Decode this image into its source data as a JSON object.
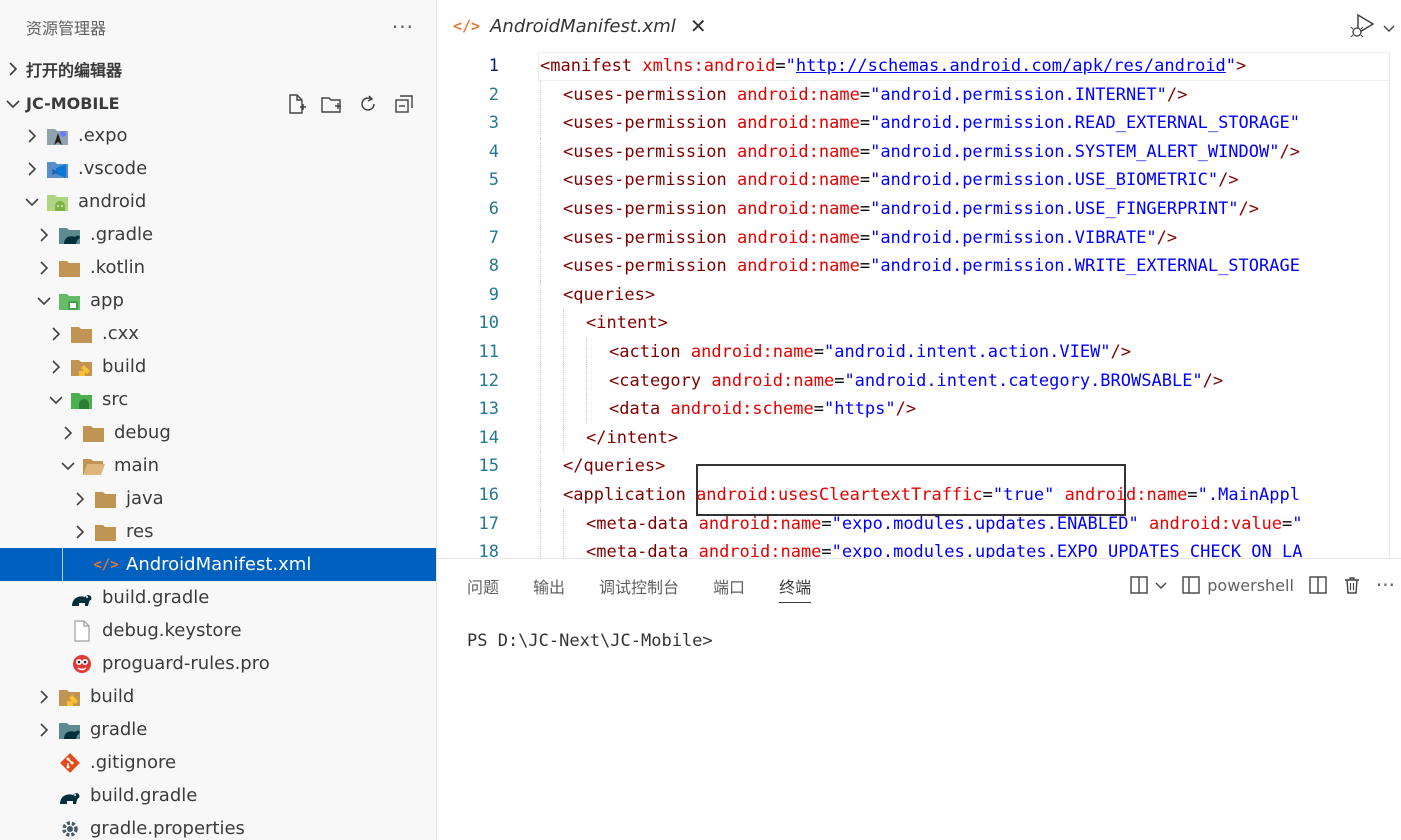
{
  "explorer": {
    "title": "资源管理器",
    "more": "···",
    "open_editors": "打开的编辑器",
    "workspace": "JC-MOBILE"
  },
  "tree": [
    {
      "label": ".expo",
      "level": 0,
      "chevron": "right",
      "icon": "expo-folder-icon"
    },
    {
      "label": ".vscode",
      "level": 0,
      "chevron": "right",
      "icon": "vscode-folder-icon"
    },
    {
      "label": "android",
      "level": 0,
      "chevron": "down",
      "icon": "android-folder-icon"
    },
    {
      "label": ".gradle",
      "level": 1,
      "chevron": "right",
      "icon": "gradle-folder-icon"
    },
    {
      "label": ".kotlin",
      "level": 1,
      "chevron": "right",
      "icon": "folder-icon"
    },
    {
      "label": "app",
      "level": 1,
      "chevron": "down",
      "icon": "app-folder-icon"
    },
    {
      "label": ".cxx",
      "level": 2,
      "chevron": "right",
      "icon": "folder-icon"
    },
    {
      "label": "build",
      "level": 2,
      "chevron": "right",
      "icon": "build-folder-icon"
    },
    {
      "label": "src",
      "level": 2,
      "chevron": "down",
      "icon": "src-folder-icon"
    },
    {
      "label": "debug",
      "level": 3,
      "chevron": "right",
      "icon": "folder-icon"
    },
    {
      "label": "main",
      "level": 3,
      "chevron": "down",
      "icon": "folder-open-icon"
    },
    {
      "label": "java",
      "level": 4,
      "chevron": "right",
      "icon": "folder-icon"
    },
    {
      "label": "res",
      "level": 4,
      "chevron": "right",
      "icon": "folder-icon"
    },
    {
      "label": "AndroidManifest.xml",
      "level": 4,
      "chevron": "none",
      "icon": "xml-file-icon",
      "selected": true
    },
    {
      "label": "build.gradle",
      "level": 2,
      "chevron": "none",
      "icon": "gradle-file-icon"
    },
    {
      "label": "debug.keystore",
      "level": 2,
      "chevron": "none",
      "icon": "file-icon"
    },
    {
      "label": "proguard-rules.pro",
      "level": 2,
      "chevron": "none",
      "icon": "proguard-file-icon"
    },
    {
      "label": "build",
      "level": 1,
      "chevron": "right",
      "icon": "build-folder-icon"
    },
    {
      "label": "gradle",
      "level": 1,
      "chevron": "right",
      "icon": "gradle-folder-icon"
    },
    {
      "label": ".gitignore",
      "level": 1,
      "chevron": "none",
      "icon": "git-file-icon"
    },
    {
      "label": "build.gradle",
      "level": 1,
      "chevron": "none",
      "icon": "gradle-file-icon"
    },
    {
      "label": "gradle.properties",
      "level": 1,
      "chevron": "none",
      "icon": "gear-file-icon"
    }
  ],
  "editor": {
    "tab_icon": "</>",
    "tab_label": "AndroidManifest.xml",
    "tab_close": "✕",
    "active_line": 1
  },
  "code_lines": [
    {
      "n": "1",
      "indent": 0,
      "t": [
        [
          "tg",
          "<manifest "
        ],
        [
          "at",
          "xmlns:android"
        ],
        [
          "tx",
          "="
        ],
        [
          "vl",
          "\""
        ],
        [
          "vlu",
          "http://schemas.android.com/apk/res/android"
        ],
        [
          "vl",
          "\""
        ],
        [
          "tg",
          ">"
        ]
      ]
    },
    {
      "n": "2",
      "indent": 1,
      "t": [
        [
          "tg",
          "<uses-permission "
        ],
        [
          "at",
          "android:name"
        ],
        [
          "tx",
          "="
        ],
        [
          "vl",
          "\"android.permission.INTERNET\""
        ],
        [
          "tg",
          "/>"
        ]
      ]
    },
    {
      "n": "3",
      "indent": 1,
      "t": [
        [
          "tg",
          "<uses-permission "
        ],
        [
          "at",
          "android:name"
        ],
        [
          "tx",
          "="
        ],
        [
          "vl",
          "\"android.permission.READ_EXTERNAL_STORAGE\""
        ]
      ]
    },
    {
      "n": "4",
      "indent": 1,
      "t": [
        [
          "tg",
          "<uses-permission "
        ],
        [
          "at",
          "android:name"
        ],
        [
          "tx",
          "="
        ],
        [
          "vl",
          "\"android.permission.SYSTEM_ALERT_WINDOW\""
        ],
        [
          "tg",
          "/>"
        ]
      ]
    },
    {
      "n": "5",
      "indent": 1,
      "t": [
        [
          "tg",
          "<uses-permission "
        ],
        [
          "at",
          "android:name"
        ],
        [
          "tx",
          "="
        ],
        [
          "vl",
          "\"android.permission.USE_BIOMETRIC\""
        ],
        [
          "tg",
          "/>"
        ]
      ]
    },
    {
      "n": "6",
      "indent": 1,
      "t": [
        [
          "tg",
          "<uses-permission "
        ],
        [
          "at",
          "android:name"
        ],
        [
          "tx",
          "="
        ],
        [
          "vl",
          "\"android.permission.USE_FINGERPRINT\""
        ],
        [
          "tg",
          "/>"
        ]
      ]
    },
    {
      "n": "7",
      "indent": 1,
      "t": [
        [
          "tg",
          "<uses-permission "
        ],
        [
          "at",
          "android:name"
        ],
        [
          "tx",
          "="
        ],
        [
          "vl",
          "\"android.permission.VIBRATE\""
        ],
        [
          "tg",
          "/>"
        ]
      ]
    },
    {
      "n": "8",
      "indent": 1,
      "t": [
        [
          "tg",
          "<uses-permission "
        ],
        [
          "at",
          "android:name"
        ],
        [
          "tx",
          "="
        ],
        [
          "vl",
          "\"android.permission.WRITE_EXTERNAL_STORAGE"
        ]
      ]
    },
    {
      "n": "9",
      "indent": 1,
      "t": [
        [
          "tg",
          "<queries>"
        ]
      ]
    },
    {
      "n": "10",
      "indent": 2,
      "t": [
        [
          "tg",
          "<intent>"
        ]
      ]
    },
    {
      "n": "11",
      "indent": 3,
      "t": [
        [
          "tg",
          "<action "
        ],
        [
          "at",
          "android:name"
        ],
        [
          "tx",
          "="
        ],
        [
          "vl",
          "\"android.intent.action.VIEW\""
        ],
        [
          "tg",
          "/>"
        ]
      ]
    },
    {
      "n": "12",
      "indent": 3,
      "t": [
        [
          "tg",
          "<category "
        ],
        [
          "at",
          "android:name"
        ],
        [
          "tx",
          "="
        ],
        [
          "vl",
          "\"android.intent.category.BROWSABLE\""
        ],
        [
          "tg",
          "/>"
        ]
      ]
    },
    {
      "n": "13",
      "indent": 3,
      "t": [
        [
          "tg",
          "<data "
        ],
        [
          "at",
          "android:scheme"
        ],
        [
          "tx",
          "="
        ],
        [
          "vl",
          "\"https\""
        ],
        [
          "tg",
          "/>"
        ]
      ]
    },
    {
      "n": "14",
      "indent": 2,
      "t": [
        [
          "tg",
          "</intent>"
        ]
      ]
    },
    {
      "n": "15",
      "indent": 1,
      "t": [
        [
          "tg",
          "</queries>"
        ]
      ]
    },
    {
      "n": "16",
      "indent": 1,
      "t": [
        [
          "tg",
          "<application "
        ],
        [
          "at",
          "android:usesCleartextTraffic"
        ],
        [
          "tx",
          "="
        ],
        [
          "vl",
          "\"true\""
        ],
        [
          "tx",
          " "
        ],
        [
          "at",
          "android:name"
        ],
        [
          "tx",
          "="
        ],
        [
          "vl",
          "\".MainAppl"
        ]
      ]
    },
    {
      "n": "17",
      "indent": 2,
      "t": [
        [
          "tg",
          "<meta-data "
        ],
        [
          "at",
          "android:name"
        ],
        [
          "tx",
          "="
        ],
        [
          "vl",
          "\"expo.modules.updates.ENABLED\""
        ],
        [
          "tx",
          " "
        ],
        [
          "at",
          "android:value"
        ],
        [
          "tx",
          "="
        ],
        [
          "vl",
          "\""
        ]
      ]
    },
    {
      "n": "18",
      "indent": 2,
      "t": [
        [
          "tg",
          "<meta-data "
        ],
        [
          "at",
          "android:name"
        ],
        [
          "tx",
          "="
        ],
        [
          "vl",
          "\"expo.modules.updates.EXPO_UPDATES_CHECK_ON_LA"
        ]
      ]
    }
  ],
  "panel": {
    "tabs": [
      "问题",
      "输出",
      "调试控制台",
      "端口",
      "终端"
    ],
    "active_tab": 4,
    "shell_label": "powershell",
    "more": "···",
    "terminal_text": "PS D:\\JC-Next\\JC-Mobile>"
  },
  "colors": {
    "selection": "#0060c0",
    "tag": "#800000",
    "attr": "#e50000",
    "value": "#0000ff",
    "line_number": "#237893"
  }
}
